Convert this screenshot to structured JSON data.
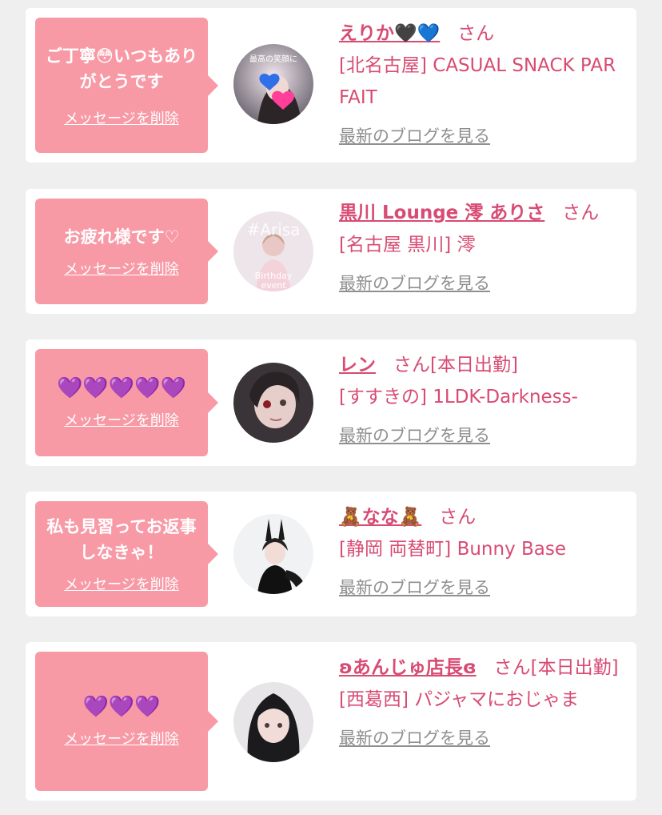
{
  "delete_label": "メッセージを削除",
  "blog_label": "最新のブログを見る",
  "san_label": "さん",
  "colors": {
    "page_bg": "#efefef",
    "card_bg": "#ffffff",
    "bubble_bg": "#f79aa6",
    "accent": "#d84b73",
    "link_gray": "#8f8f8f"
  },
  "messages": [
    {
      "message": "ご丁寧😳いつもありがとうです",
      "name": "えりか🖤💙",
      "shop": "[北名古屋] CASUAL SNACK PARFAIT",
      "status": "",
      "avatar_text": "最高の笑顔に"
    },
    {
      "message": "お疲れ様です♡",
      "name": "黒川 Lounge 澪 ありさ",
      "shop": "[名古屋 黒川] 澪",
      "status": "",
      "avatar_text": "#Arisa Birthday event"
    },
    {
      "message": "💜💜💜💜💜",
      "name": "レン",
      "shop": "[すすきの] 1LDK-Darkness-",
      "status": "[本日出勤]",
      "avatar_text": ""
    },
    {
      "message": "私も見習ってお返事しなきゃ！",
      "name": "🧸なな🧸",
      "shop": "[静岡 両替町] Bunny Base",
      "status": "",
      "avatar_text": ""
    },
    {
      "message": "💜💜💜",
      "name": "ʚあんじゅ店長ɞ",
      "shop": "[西葛西] パジャマにおじゃま",
      "status": "[本日出勤]",
      "avatar_text": ""
    }
  ]
}
